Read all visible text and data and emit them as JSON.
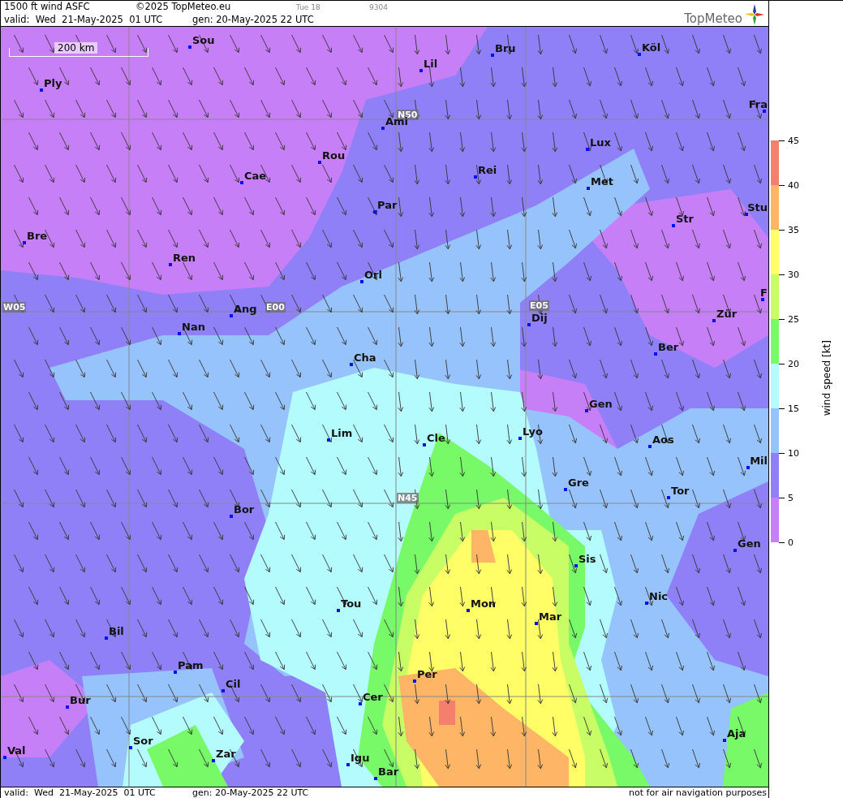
{
  "header": {
    "title": "1500 ft wind ASFC",
    "copyright": "©2025 TopMeteo.eu",
    "run_label": "Tue 18",
    "code": "9304",
    "valid": "valid:  Wed  21-May-2025  01 UTC",
    "generated": "gen: 20-May-2025 22 UTC",
    "logo_text": "TopMeteo"
  },
  "map": {
    "scale_label": "200 km",
    "grid_labels": [
      "N50",
      "W05",
      "E00",
      "E05",
      "N45"
    ],
    "cities": [
      "Sou",
      "Ply",
      "Lil",
      "Bru",
      "Köl",
      "Fra",
      "Ami",
      "Rou",
      "Lux",
      "Cae",
      "Rei",
      "Met",
      "Par",
      "Stu",
      "Str",
      "Bre",
      "Ren",
      "Orl",
      "F",
      "Ang",
      "Dij",
      "Zür",
      "Nan",
      "Ber",
      "Cha",
      "Gen",
      "Lim",
      "Cle",
      "Lyo",
      "Aos",
      "Mil",
      "Gre",
      "Tor",
      "Bor",
      "Gen",
      "Sis",
      "Nic",
      "Tou",
      "Mon",
      "Mar",
      "Bil",
      "Pam",
      "Per",
      "Cil",
      "Bur",
      "Cer",
      "Aja",
      "Sor",
      "Val",
      "Zar",
      "Igu",
      "Bar"
    ]
  },
  "legend": {
    "title": "wind speed [kt]",
    "ticks": [
      "45",
      "40",
      "35",
      "30",
      "25",
      "20",
      "15",
      "10",
      "5",
      "0"
    ],
    "bands": [
      {
        "color": "#f47f6c"
      },
      {
        "color": "#ffb566"
      },
      {
        "color": "#fffe66"
      },
      {
        "color": "#c8fd66"
      },
      {
        "color": "#77f968"
      },
      {
        "color": "#b3fbfd"
      },
      {
        "color": "#96c3fc"
      },
      {
        "color": "#8f80f8"
      },
      {
        "color": "#c77ff7"
      }
    ]
  },
  "footer": {
    "valid": "valid:  Wed  21-May-2025  01 UTC",
    "generated": "gen: 20-May-2025 22 UTC",
    "disclaimer": "not for air navigation purposes"
  }
}
